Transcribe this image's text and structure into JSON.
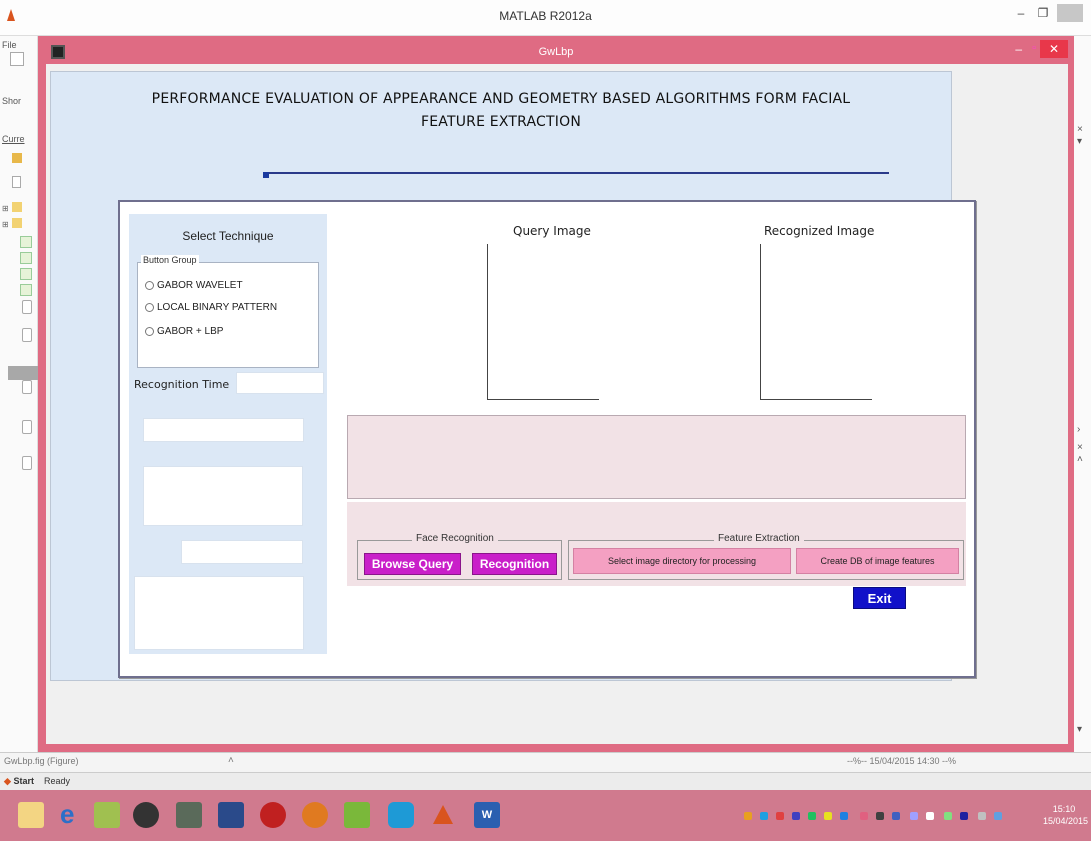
{
  "matlab": {
    "title": "MATLAB R2012a",
    "menu_file": "File",
    "left_labels": [
      "Shor",
      "Curre"
    ],
    "bottom_left": "GwLbp.fig (Figure)",
    "bottom_right": "--%-- 15/04/2015 14:30 --%",
    "status_start": "Start",
    "status_ready": "Ready"
  },
  "figure": {
    "title": "GwLbp",
    "app_title_line1": "PERFORMANCE EVALUATION OF APPEARANCE AND GEOMETRY BASED ALGORITHMS FORM FACIAL",
    "app_title_line2": "FEATURE EXTRACTION",
    "select_technique": "Select Technique",
    "button_group_legend": "Button Group",
    "radios": [
      "GABOR WAVELET",
      "LOCAL BINARY PATTERN",
      "GABOR + LBP"
    ],
    "recognition_time_label": "Recognition Time",
    "query_image_label": "Query Image",
    "recognized_image_label": "Recognized Image",
    "face_recognition_legend": "Face Recognition",
    "feature_extraction_legend": "Feature Extraction",
    "browse_query": "Browse Query",
    "recognition": "Recognition",
    "select_dir": "Select image directory for processing",
    "create_db": "Create DB of image features",
    "exit": "Exit"
  },
  "taskbar": {
    "clock_time": "15:10",
    "clock_date": "15/04/2015"
  },
  "colors": {
    "figure_frame": "#df6b83",
    "taskbar": "#d07a8e",
    "purple_button": "#c91fc9",
    "pink_button": "#f4a0c2",
    "exit_button": "#1111c9"
  }
}
